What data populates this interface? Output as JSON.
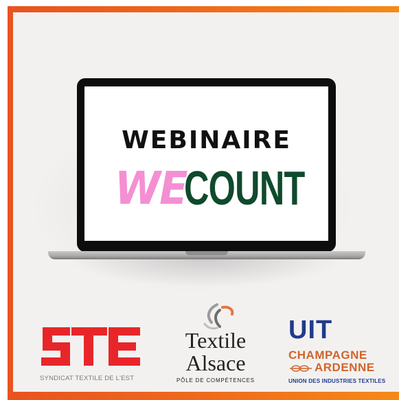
{
  "screen": {
    "line1": "WEBINAIRE",
    "logo_part1": "WE",
    "logo_part2": "COUNT"
  },
  "partners": {
    "ste": {
      "tagline": "SYNDICAT TEXTILE DE L'EST"
    },
    "textile_alsace": {
      "name_line1": "Textile",
      "name_line2": "Alsace",
      "tagline": "PÔLE DE COMPÉTENCES"
    },
    "uit": {
      "acronym": "UIT",
      "region_line1": "CHAMPAGNE",
      "region_line2": "ARDENNE",
      "tagline": "UNION DES INDUSTRIES TEXTILES"
    }
  },
  "colors": {
    "frame_gradient_start": "#e8531f",
    "frame_gradient_end": "#f58a17",
    "background": "#f3f1f0",
    "we_pink": "#f48fd3",
    "count_green": "#0f4a2c",
    "ste_red": "#e8262a",
    "uit_blue": "#1f3b8c",
    "uit_orange": "#d0642a"
  }
}
